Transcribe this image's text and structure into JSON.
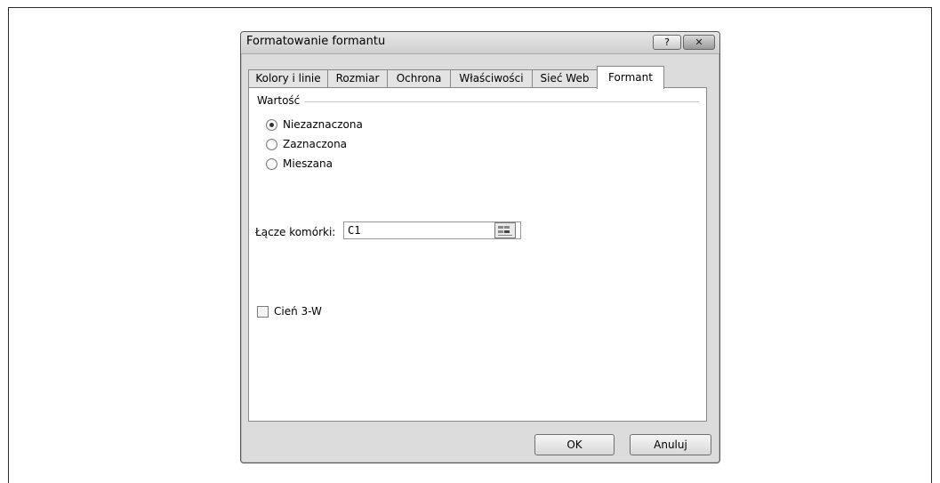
{
  "dialog": {
    "title": "Formatowanie formantu",
    "help_glyph": "?",
    "close_glyph": "✕"
  },
  "tabs": [
    {
      "label": "Kolory i linie"
    },
    {
      "label": "Rozmiar"
    },
    {
      "label": "Ochrona"
    },
    {
      "label": "Właściwości"
    },
    {
      "label": "Sieć Web"
    },
    {
      "label": "Formant"
    }
  ],
  "active_tab": "Formant",
  "value_group": {
    "label": "Wartość",
    "options": [
      {
        "label": "Niezaznaczona",
        "checked": true
      },
      {
        "label": "Zaznaczona",
        "checked": false
      },
      {
        "label": "Mieszana",
        "checked": false
      }
    ]
  },
  "cell_link": {
    "label": "Łącze komórki:",
    "value": "C1"
  },
  "shadow_3d": {
    "label": "Cień 3-W",
    "checked": false
  },
  "buttons": {
    "ok": "OK",
    "cancel": "Anuluj"
  }
}
